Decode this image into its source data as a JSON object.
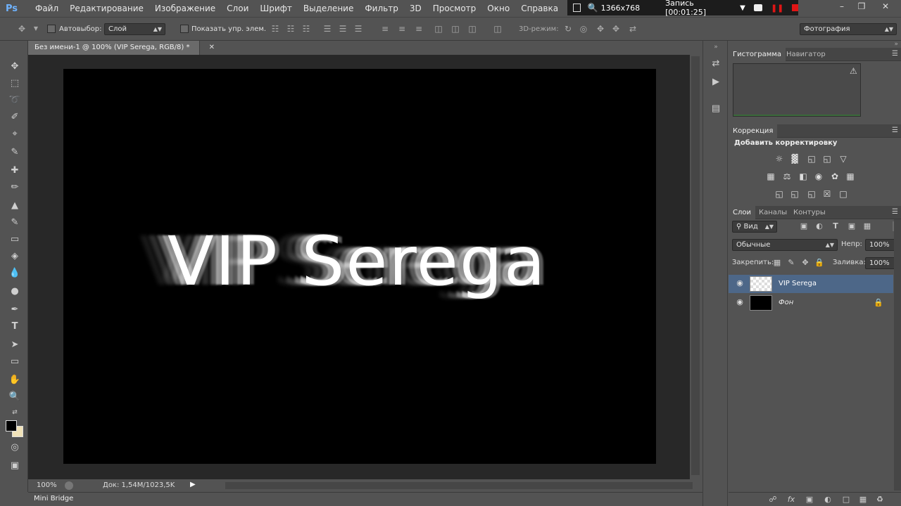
{
  "app": {
    "logo": "Ps"
  },
  "menu": [
    "Файл",
    "Редактирование",
    "Изображение",
    "Слои",
    "Шрифт",
    "Выделение",
    "Фильтр",
    "3D",
    "Просмотр",
    "Окно",
    "Справка"
  ],
  "recorder": {
    "resolution": "1366x768",
    "label": "Запись [00:01:25]"
  },
  "window_controls": {
    "minimize": "–",
    "maximize": "❐",
    "close": "✕"
  },
  "options": {
    "autoselect_label": "Автовыбор:",
    "autoselect_value": "Слой",
    "show_transform_label": "Показать упр. элем.",
    "mode3d_label": "3D-режим:",
    "workspace": "Фотография"
  },
  "document": {
    "tab_title": "Без имени-1 @ 100% (VIP Serega, RGB/8) *",
    "canvas_text": "VIP Serega",
    "background_color": "#000000"
  },
  "status": {
    "zoom": "100%",
    "doc": "Док: 1,54M/1023,5K"
  },
  "minibridge": {
    "label": "Mini Bridge"
  },
  "panels": {
    "histogram_tabs": [
      "Гистограмма",
      "Навигатор"
    ],
    "correction_tab": "Коррекция",
    "correction_title": "Добавить корректировку",
    "layers_tabs": [
      "Слои",
      "Каналы",
      "Контуры"
    ],
    "filter_kind": "Вид",
    "blend_mode": "Обычные",
    "opacity_label": "Непр:",
    "opacity_value": "100%",
    "lock_label": "Закрепить:",
    "fill_label": "Заливка:",
    "fill_value": "100%",
    "layers": [
      {
        "name": "VIP Serega",
        "selected": true,
        "locked": false
      },
      {
        "name": "Фон",
        "selected": false,
        "locked": true
      }
    ]
  },
  "colors": {
    "ui_bg": "#535353",
    "workarea": "#282828",
    "selection": "#4d6788",
    "foreground": "#000000",
    "background_swatch": "#f1e3b9"
  },
  "icons": {
    "move": "move-icon",
    "marquee": "marquee-icon",
    "lasso": "lasso-icon",
    "quick-select": "quick-select-icon",
    "crop": "crop-icon",
    "eyedropper": "eyedropper-icon",
    "healing": "healing-brush-icon",
    "brush": "brush-icon",
    "stamp": "clone-stamp-icon",
    "history-brush": "history-brush-icon",
    "eraser": "eraser-icon",
    "bucket": "paint-bucket-icon",
    "blur": "blur-icon",
    "dodge": "dodge-icon",
    "pen": "pen-icon",
    "type": "type-icon",
    "path-select": "path-selection-icon",
    "shape": "rectangle-shape-icon",
    "hand": "hand-icon",
    "zoom": "zoom-icon",
    "quickmask": "quick-mask-icon",
    "screenmode": "screen-mode-icon"
  }
}
